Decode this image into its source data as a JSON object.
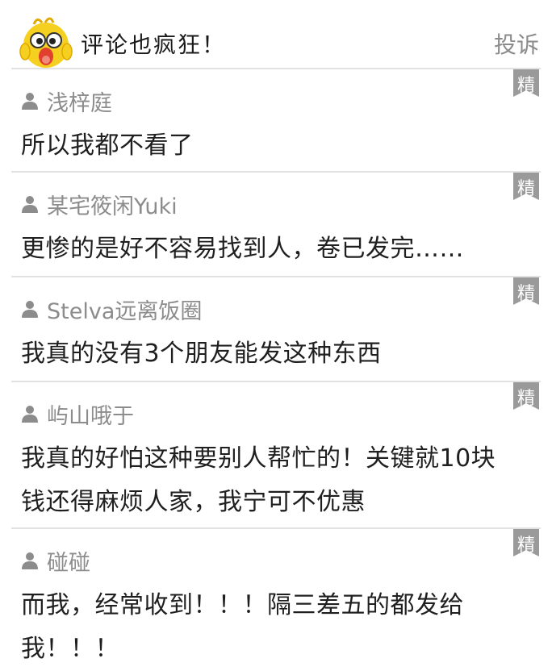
{
  "header": {
    "title": "评论也疯狂！",
    "report_label": "投诉"
  },
  "comments": [
    {
      "user": "浅梓庭",
      "text": "所以我都不看了",
      "badge": "精"
    },
    {
      "user": "某宅筱闲Yuki",
      "text": "更惨的是好不容易找到人，卷已发完……",
      "badge": "精"
    },
    {
      "user": "Stelva远离饭圈",
      "text": "我真的没有3个朋友能发这种东西",
      "badge": "精"
    },
    {
      "user": "屿山哦于",
      "text": "我真的好怕这种要别人帮忙的！关键就10块钱还得麻烦人家，我宁可不优惠",
      "badge": "精"
    },
    {
      "user": "碰碰",
      "text": "而我，经常收到！！！隔三差五的都发给我！！！",
      "badge": "精"
    }
  ],
  "colors": {
    "badge": "#9a9a9a",
    "divider": "#e2e2e2",
    "username": "#8c8c8c",
    "mascot_yellow": "#f5d020"
  },
  "icons": {
    "mascot": "yellow-cartoon-chick-mascot",
    "user": "person-silhouette-icon",
    "badge": "featured-ribbon-badge"
  }
}
